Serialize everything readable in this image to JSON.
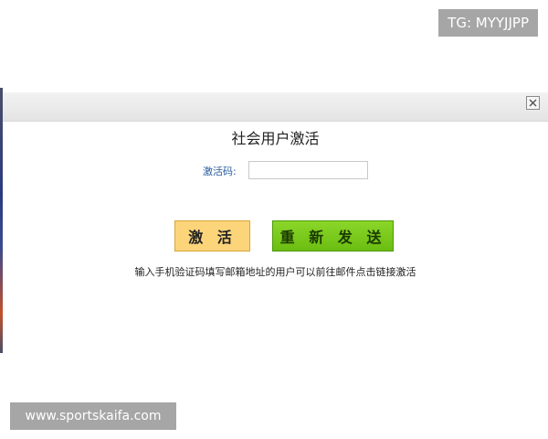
{
  "badge": {
    "text": "TG: MYYJJPP"
  },
  "dialog": {
    "title": "社会用户激活",
    "code_label": "激活码:",
    "code_value": "",
    "activate_label": "激 活",
    "resend_label": "重 新 发 送",
    "hint": "输入手机验证码填写邮箱地址的用户可以前往邮件点击链接激活"
  },
  "watermark": {
    "text": "www.sportskaifa.com"
  },
  "colors": {
    "activate_button": "#fcd47a",
    "resend_button": "#7ccc1c",
    "label_blue": "#2a5d9f",
    "badge_gray": "#a6a6a6"
  },
  "icons": {
    "close": "close-icon"
  }
}
